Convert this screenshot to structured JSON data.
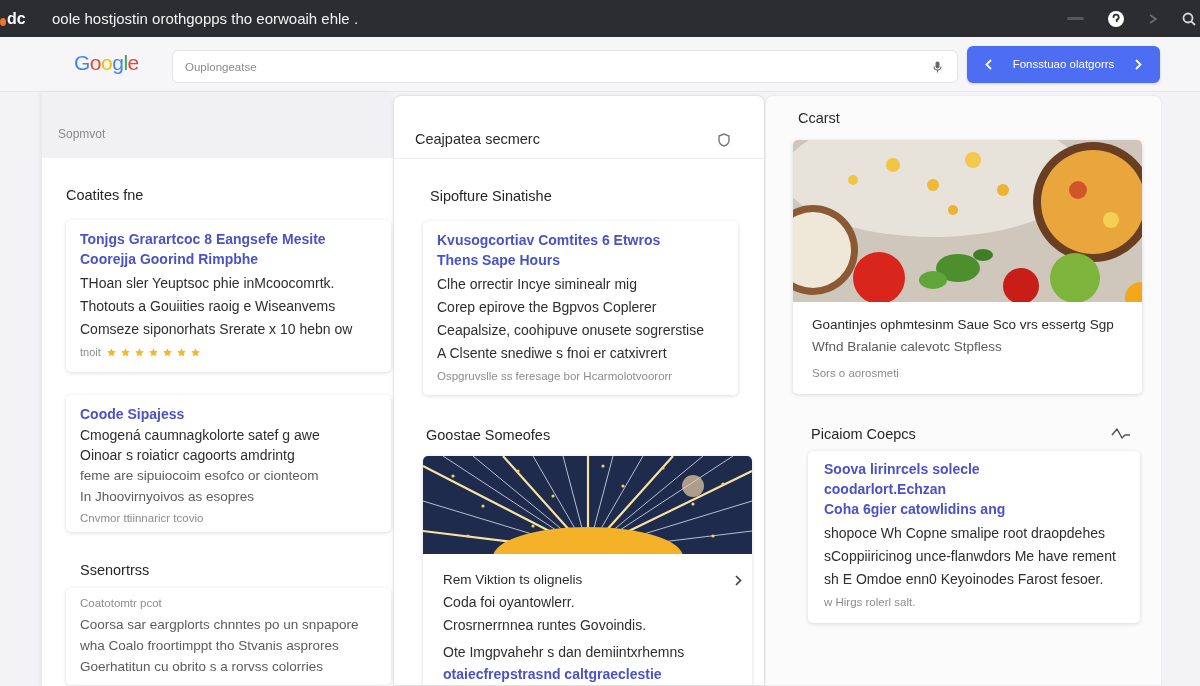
{
  "top_bar": {
    "logo": "dc",
    "title": "oole hostjostin orothgopps tho eorwoaih ehle ."
  },
  "header": {
    "logo": "Google",
    "search": {
      "placeholder": "Ouplongeatse"
    },
    "button": {
      "label": "Fonsstuao olatgorrs"
    }
  },
  "columns": [
    {
      "heading": "Sopmvot",
      "sections": [
        {
          "title": "Coatites fne",
          "cards": [
            {
              "kind": "text",
              "lines": [
                {
                  "kind": "link",
                  "text": "Tonjgs Grarartcoc 8 Eangsefe Mesite"
                },
                {
                  "kind": "link",
                  "text": "Coorejja Goorind Rimpbhe"
                },
                {
                  "kind": "body",
                  "text": "THoan sler Yeuptsoc phie inMcoocomrtk."
                },
                {
                  "kind": "body",
                  "text": "Thotouts a Gouiities raoig e Wiseanvems"
                },
                {
                  "kind": "body",
                  "text": "Comseze siponorhats Srerate x 10 hebn ow"
                },
                {
                  "kind": "rating",
                  "text": "tnoit",
                  "stars": 7
                }
              ]
            },
            {
              "kind": "text",
              "lines": [
                {
                  "kind": "link",
                  "text": "Coode Sipajess"
                },
                {
                  "kind": "body",
                  "text": "Cmogená caumnagkolorte satef g awe"
                },
                {
                  "kind": "body",
                  "text": "Oinoar s roiaticr cagoorts amdrintg"
                },
                {
                  "kind": "muted",
                  "text": "feme are sipuiocoim esofco or cionteom"
                },
                {
                  "kind": "muted",
                  "text": "In Jhoovirnyoivos as esopres"
                },
                {
                  "kind": "meta",
                  "text": "Cnvmor ttiinnaricr tcovio"
                }
              ]
            }
          ]
        },
        {
          "title": "Ssenortrss",
          "cards": [
            {
              "kind": "text",
              "lines": [
                {
                  "kind": "meta",
                  "text": "Coatotomtr pcot"
                },
                {
                  "kind": "muted",
                  "text": "Coorsa sar eargplorts chnntes po un snpapore"
                },
                {
                  "kind": "muted",
                  "text": "wha Coalo froortimppt tho Stvanis asprores"
                },
                {
                  "kind": "muted",
                  "text": "Goerhatitun cu obrito s a rorvss colorries"
                }
              ]
            }
          ]
        }
      ]
    },
    {
      "heading": "Ceajpatea secmerc",
      "sections": [
        {
          "title": "Sipofture Sinatishe",
          "cards": [
            {
              "kind": "text",
              "lines": [
                {
                  "kind": "link",
                  "text": "Kvusogcortiav Comtites 6 Etwros"
                },
                {
                  "kind": "link",
                  "text": "Thens Sape Hours"
                },
                {
                  "kind": "body",
                  "text": "Clhe orrectir Incye siminealr mig"
                },
                {
                  "kind": "body",
                  "text": "Corep epirove the Bgpvos Coplerer"
                },
                {
                  "kind": "body",
                  "text": "Ceapalsize, coohipuve onusete sogrerstise"
                },
                {
                  "kind": "body",
                  "text": "A Clsente snediwe s fnoi er catxivrert"
                },
                {
                  "kind": "meta",
                  "text": "Ospgruvslle ss feresage bor Hcarmolotvoororr"
                }
              ]
            }
          ]
        },
        {
          "title": "Goostae Someofes",
          "cards": [
            {
              "kind": "burst",
              "lines": [
                {
                  "kind": "lead",
                  "text": "Rem Viktion ts olignelis",
                  "chevron": true
                },
                {
                  "kind": "body",
                  "text": "Coda foi oyantowlerr."
                },
                {
                  "kind": "body",
                  "text": "Crosrnerrnnea runtes Govoindis."
                },
                {
                  "kind": "body",
                  "text": "Ote Imgpvahehr s dan demiintxrhemns"
                },
                {
                  "kind": "link",
                  "text": "otaiecfrepstrasnd caltgraeclestie"
                }
              ]
            }
          ]
        }
      ]
    },
    {
      "heading": "Ccarst",
      "sections": [
        {
          "cards": [
            {
              "kind": "food",
              "lines": [
                {
                  "kind": "lead",
                  "text": "Goantinjes ophmtesinm Saue Sco vrs essertg Sgp"
                },
                {
                  "kind": "muted",
                  "text": "Wfnd Bralanie calevotc Stpfless"
                },
                {
                  "kind": "meta",
                  "text": "Sors o aorosmeti"
                }
              ]
            }
          ]
        },
        {
          "title": "Picaiom Coepcs",
          "cards": [
            {
              "kind": "text",
              "lines": [
                {
                  "kind": "link",
                  "text": "Soova lirinrcels solecle"
                },
                {
                  "kind": "link",
                  "text": "coodarlort.Echzan"
                },
                {
                  "kind": "link",
                  "text": "Coha 6gier catowlidins ang"
                },
                {
                  "kind": "body",
                  "text": "shopoce Wh Copne smalipe root draopdehes"
                },
                {
                  "kind": "body",
                  "text": "sCoppiiricinog unce-flanwdors Me have rement"
                },
                {
                  "kind": "body",
                  "text": "sh E Omdoe enn0 Keyoinodes Farost fesoer."
                },
                {
                  "kind": "meta",
                  "text": "w Hirgs rolerl salt."
                }
              ]
            }
          ]
        }
      ]
    }
  ]
}
